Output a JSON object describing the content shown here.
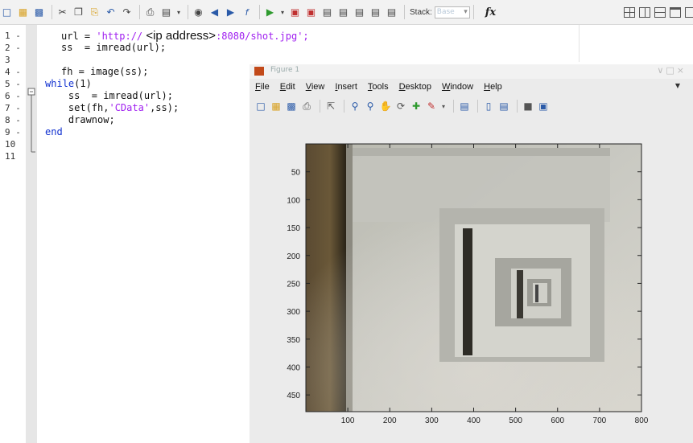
{
  "toolbar": {
    "stack_label": "Stack:",
    "stack_value": "Base",
    "fx_label": "fx",
    "icons": [
      "new-file-icon",
      "open-folder-icon",
      "save-icon",
      "cut-icon",
      "copy-icon",
      "paste-icon",
      "undo-icon",
      "redo-icon",
      "print-icon",
      "preview-icon",
      "find-icon",
      "back-arrow-icon",
      "forward-arrow-icon",
      "function-icon",
      "run-icon",
      "breakpoint-set-icon",
      "breakpoint-clear-icon",
      "step-icon",
      "step-in-icon",
      "step-out-icon",
      "continue-icon",
      "exit-debug-icon",
      "tile-icon",
      "split-vertical-icon",
      "split-horizontal-icon",
      "float-icon"
    ]
  },
  "editor": {
    "line_numbers": [
      "1",
      "2",
      "3",
      "4",
      "5",
      "6",
      "7",
      "8",
      "9",
      "10",
      "11"
    ],
    "line_markers": [
      "-",
      "-",
      "",
      "-",
      "-",
      "-",
      "-",
      "-",
      "-",
      "",
      ""
    ],
    "lines": [
      {
        "tokens": [
          {
            "t": "url = ",
            "c": "plain"
          },
          {
            "t": "'http://",
            "c": "str"
          },
          {
            "t": " <ip address>",
            "c": "annot"
          },
          {
            "t": ":8080/shot.jpg';",
            "c": "str"
          }
        ]
      },
      {
        "tokens": [
          {
            "t": "ss  = imread(url);",
            "c": "plain"
          }
        ]
      },
      {
        "tokens": []
      },
      {
        "tokens": [
          {
            "t": "fh = image(ss);",
            "c": "plain"
          }
        ]
      },
      {
        "tokens": [
          {
            "t": "while",
            "c": "kw"
          },
          {
            "t": "(1)",
            "c": "plain"
          }
        ]
      },
      {
        "tokens": [
          {
            "t": "    ss  = imread(url);",
            "c": "plain"
          }
        ]
      },
      {
        "tokens": [
          {
            "t": "    set(fh,",
            "c": "plain"
          },
          {
            "t": "'CData'",
            "c": "str"
          },
          {
            "t": ",ss);",
            "c": "plain"
          }
        ]
      },
      {
        "tokens": [
          {
            "t": "    drawnow;",
            "c": "plain"
          }
        ]
      },
      {
        "tokens": [
          {
            "t": "end",
            "c": "kw"
          }
        ]
      },
      {
        "tokens": []
      },
      {
        "tokens": []
      }
    ]
  },
  "figure": {
    "title": "Figure 1",
    "menus": [
      "File",
      "Edit",
      "View",
      "Insert",
      "Tools",
      "Desktop",
      "Window",
      "Help"
    ],
    "tool_icons": [
      "new-figure-icon",
      "open-icon",
      "save-icon",
      "print-icon",
      "pointer-icon",
      "zoom-in-icon",
      "zoom-out-icon",
      "pan-icon",
      "rotate-icon",
      "data-cursor-icon",
      "brush-icon",
      "link-icon",
      "colorbar-icon",
      "legend-icon",
      "hide-tools-icon",
      "show-tools-icon"
    ],
    "axes": {
      "x_ticks": [
        "100",
        "200",
        "300",
        "400",
        "500",
        "600",
        "700",
        "800"
      ],
      "y_ticks": [
        "50",
        "100",
        "150",
        "200",
        "250",
        "300",
        "350",
        "400",
        "450"
      ],
      "xlim": [
        0,
        800
      ],
      "ylim": [
        0,
        480
      ]
    }
  }
}
